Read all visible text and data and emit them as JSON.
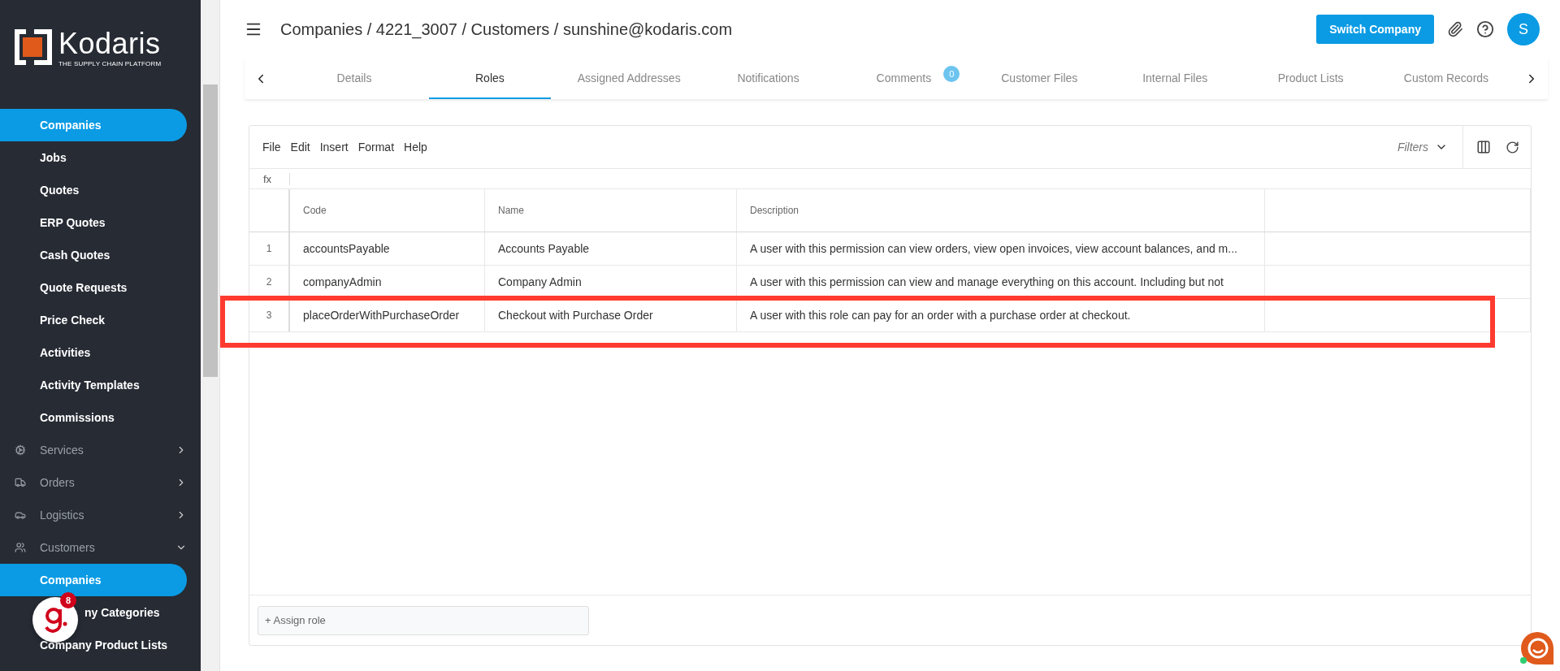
{
  "sidebar": {
    "logo": {
      "name": "Kodaris",
      "tagline": "THE SUPPLY CHAIN PLATFORM"
    },
    "items": [
      {
        "kind": "link",
        "label": "Companies",
        "selected": true
      },
      {
        "kind": "link",
        "label": "Jobs",
        "selected": false
      },
      {
        "kind": "link",
        "label": "Quotes",
        "selected": false
      },
      {
        "kind": "link",
        "label": "ERP Quotes",
        "selected": false
      },
      {
        "kind": "link",
        "label": "Cash Quotes",
        "selected": false
      },
      {
        "kind": "link",
        "label": "Quote Requests",
        "selected": false
      },
      {
        "kind": "link",
        "label": "Price Check",
        "selected": false
      },
      {
        "kind": "link",
        "label": "Activities",
        "selected": false
      },
      {
        "kind": "link",
        "label": "Activity Templates",
        "selected": false
      },
      {
        "kind": "link",
        "label": "Commissions",
        "selected": false
      },
      {
        "kind": "section",
        "label": "Services",
        "expanded": false
      },
      {
        "kind": "section",
        "label": "Orders",
        "expanded": false
      },
      {
        "kind": "section",
        "label": "Logistics",
        "expanded": false
      },
      {
        "kind": "section",
        "label": "Customers",
        "expanded": true,
        "children": [
          {
            "kind": "link",
            "label": "Companies",
            "selected": true
          },
          {
            "kind": "covered",
            "label": "ny Categories",
            "selected": false
          },
          {
            "kind": "link",
            "label": "Company Product Lists",
            "selected": false
          }
        ]
      }
    ]
  },
  "header": {
    "breadcrumb": "Companies / 4221_3007 / Customers / sunshine@kodaris.com",
    "switch_button": "Switch Company",
    "avatar": "S"
  },
  "tabs": [
    {
      "label": "Details",
      "selected": false
    },
    {
      "label": "Roles",
      "selected": true
    },
    {
      "label": "Assigned Addresses",
      "selected": false
    },
    {
      "label": "Notifications",
      "selected": false
    },
    {
      "label": "Comments",
      "selected": false,
      "badge": "0"
    },
    {
      "label": "Customer Files",
      "selected": false
    },
    {
      "label": "Internal Files",
      "selected": false
    },
    {
      "label": "Product Lists",
      "selected": false
    },
    {
      "label": "Custom Records",
      "selected": false
    }
  ],
  "grid": {
    "menu": [
      "File",
      "Edit",
      "Insert",
      "Format",
      "Help"
    ],
    "filters": "Filters",
    "formula_label": "fx",
    "columns": [
      "Code",
      "Name",
      "Description"
    ],
    "rows": [
      {
        "number": "1",
        "code": "accountsPayable",
        "name": "Accounts Payable",
        "description": "A user with this permission can view orders, view open invoices, view account balances, and m...",
        "highlighted": false
      },
      {
        "number": "2",
        "code": "companyAdmin",
        "name": "Company Admin",
        "description": "A user with this permission can view and manage everything on this account. Including but not",
        "highlighted": false
      },
      {
        "number": "3",
        "code": "placeOrderWithPurchaseOrder",
        "name": "Checkout with Purchase Order",
        "description": "A user with this role can pay for an order with a purchase order at checkout.",
        "highlighted": true
      }
    ],
    "assign_placeholder": "+ Assign role"
  },
  "widgets": {
    "notification_badge": "8"
  }
}
